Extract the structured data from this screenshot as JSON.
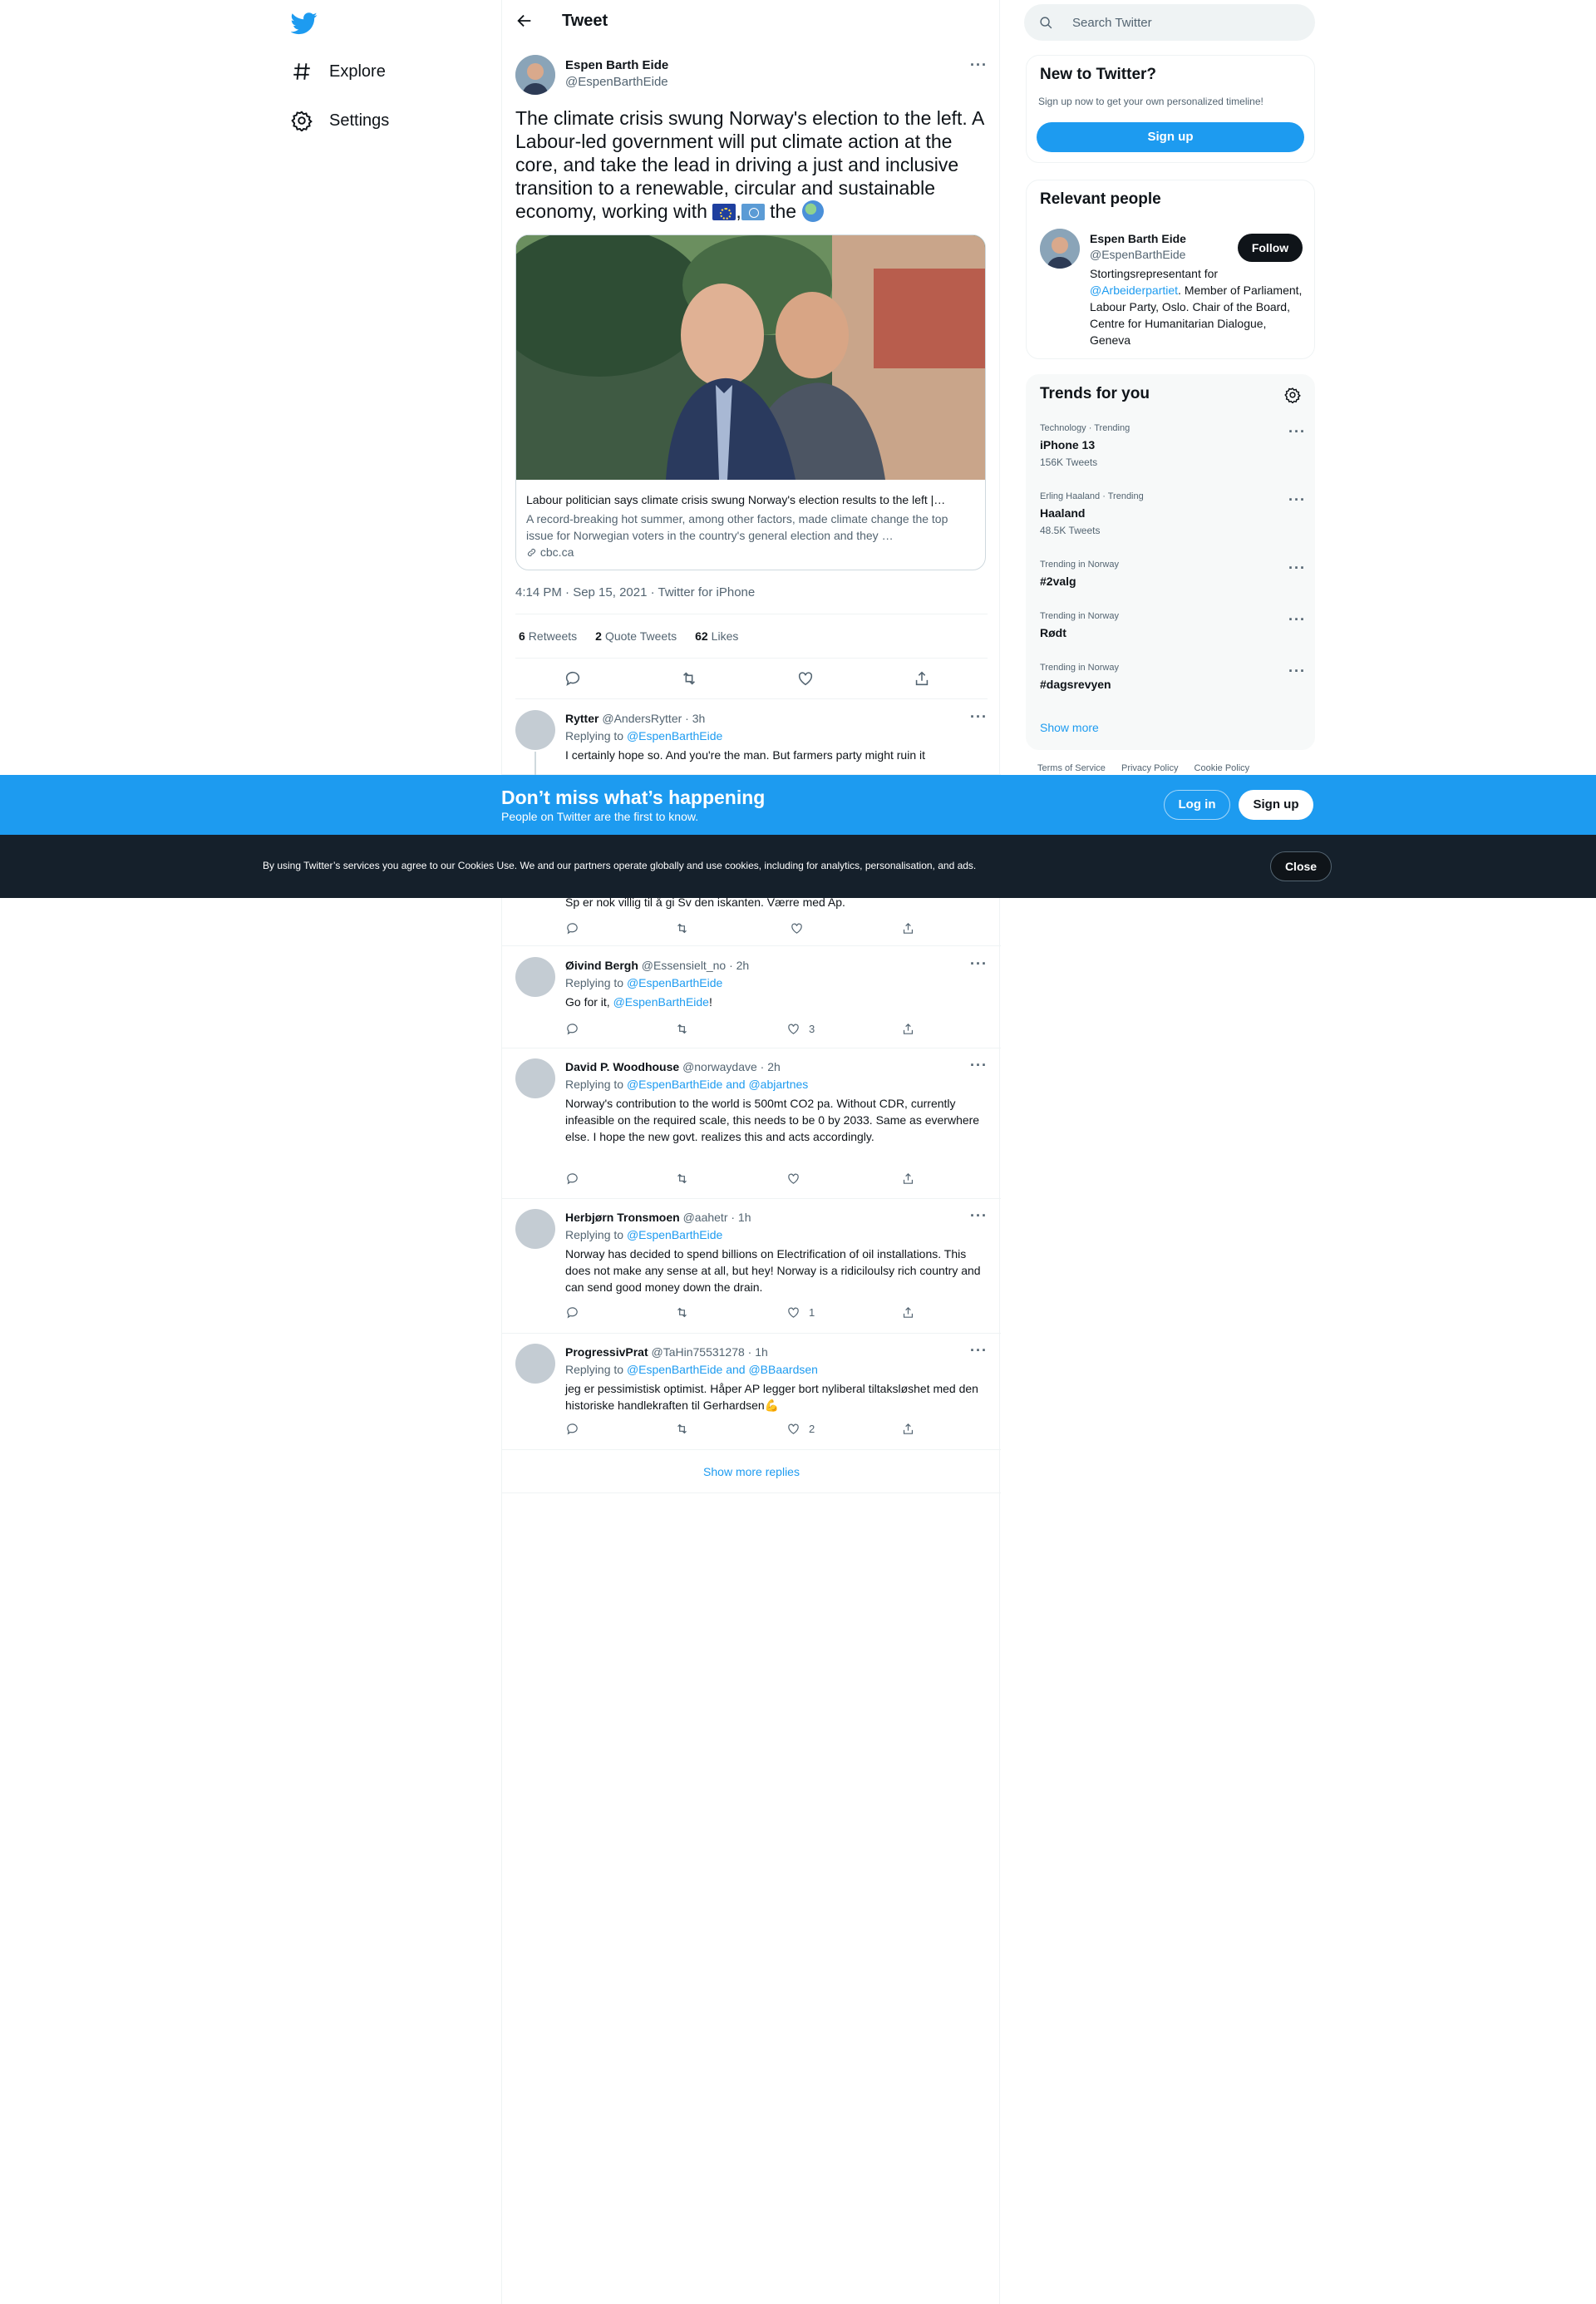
{
  "nav": {
    "explore": "Explore",
    "settings": "Settings"
  },
  "header": {
    "title": "Tweet"
  },
  "tweet": {
    "author_name": "Espen Barth Eide",
    "author_handle": "@EspenBarthEide",
    "text_main": "The climate crisis swung Norway's election to the left. A Labour-led government will put climate action at the core, and take the lead in driving a just and inclusive transition to a renewable, circular and sustainable economy, working with",
    "text_sep": ",",
    "text_end": " the",
    "card": {
      "title": "Labour politician says climate crisis swung Norway's election results to the left |…",
      "description": "A record-breaking hot summer, among other factors, made climate change the top issue for Norwegian voters in the country's general election and they …",
      "domain": "cbc.ca"
    },
    "meta": "4:14 PM · Sep 15, 2021 · Twitter for iPhone",
    "retweets_count": "6",
    "retweets_label": "Retweets",
    "quotes_count": "2",
    "quotes_label": "Quote Tweets",
    "likes_count": "62",
    "likes_label": "Likes"
  },
  "replies": [
    {
      "name": "Rytter",
      "meta": "@AndersRytter · 3h",
      "replying_prefix": "Replying to ",
      "replying_to": "@EspenBarthEide",
      "text": "I certainly hope so. And you're the man. But farmers party might ruin it"
    },
    {
      "text": "Sp er nok villig til å gi Sv den iskanten. Værre med Ap."
    },
    {
      "name": "Øivind Bergh",
      "meta": "@Essensielt_no · 2h",
      "replying_prefix": "Replying to ",
      "replying_to": "@EspenBarthEide",
      "text": "Go for it, ",
      "mention": "@EspenBarthEide",
      "text_end": "!",
      "likes": "3"
    },
    {
      "name": "David P. Woodhouse",
      "meta": "@norwaydave · 2h",
      "replying_prefix": "Replying to ",
      "replying_to": "@EspenBarthEide and @abjartnes",
      "text": "Norway's contribution to the world is 500mt CO2 pa. Without CDR, currently infeasible on the required scale, this needs to be 0 by 2033. Same as everwhere else. I hope the new govt. realizes this and acts accordingly."
    },
    {
      "name": "Herbjørn Tronsmoen",
      "meta": "@aahetr · 1h",
      "replying_prefix": "Replying to ",
      "replying_to": "@EspenBarthEide",
      "text": "Norway has decided to spend billions on Electrification of oil installations. This does not make any sense at all, but hey! Norway is a ridiciloulsy rich country and can send good money down the drain.",
      "likes": "1"
    },
    {
      "name": "ProgressivPrat",
      "meta": "@TaHin75531278 · 1h",
      "replying_prefix": "Replying to ",
      "replying_to": "@EspenBarthEide and @BBaardsen",
      "text": "jeg er pessimistisk optimist. Håper AP legger bort nyliberal tiltaksløshet med den historiske handlekraften til Gerhardsen💪",
      "likes": "2"
    }
  ],
  "show_more_replies": "Show more replies",
  "search": {
    "placeholder": "Search Twitter"
  },
  "new_to_twitter": {
    "title": "New to Twitter?",
    "subtitle": "Sign up now to get your own personalized timeline!",
    "signup": "Sign up"
  },
  "relevant_people": {
    "title": "Relevant people",
    "name": "Espen Barth Eide",
    "handle": "@EspenBarthEide",
    "follow": "Follow",
    "bio_prefix": "Stortingsrepresentant for ",
    "bio_mention": "@Arbeiderpartiet",
    "bio_rest": ". Member of Parliament, Labour Party, Oslo. Chair of the Board, Centre for Humanitarian Dialogue, Geneva"
  },
  "trends": {
    "title": "Trends for you",
    "items": [
      {
        "meta": "Technology · Trending",
        "name": "iPhone 13",
        "count": "156K Tweets"
      },
      {
        "meta": "Erling Haaland · Trending",
        "name": "Haaland",
        "count": "48.5K Tweets"
      },
      {
        "meta": "Trending in Norway",
        "name": "#2valg",
        "count": ""
      },
      {
        "meta": "Trending in Norway",
        "name": "Rødt",
        "count": ""
      },
      {
        "meta": "Trending in Norway",
        "name": "#dagsrevyen",
        "count": ""
      }
    ],
    "show_more": "Show more"
  },
  "footer": {
    "terms": "Terms of Service",
    "privacy": "Privacy Policy",
    "cookie": "Cookie Policy"
  },
  "banner": {
    "title": "Don’t miss what’s happening",
    "subtitle": "People on Twitter are the first to know.",
    "login": "Log in",
    "signup": "Sign up"
  },
  "cookie": {
    "text": "By using Twitter’s services you agree to our Cookies Use. We and our partners operate globally and use cookies, including for analytics, personalisation, and ads.",
    "close": "Close"
  },
  "colors": {
    "accent": "#1d9bf0",
    "dark": "#0f1419",
    "muted": "#536471",
    "cookie_bar": "#15202b"
  }
}
